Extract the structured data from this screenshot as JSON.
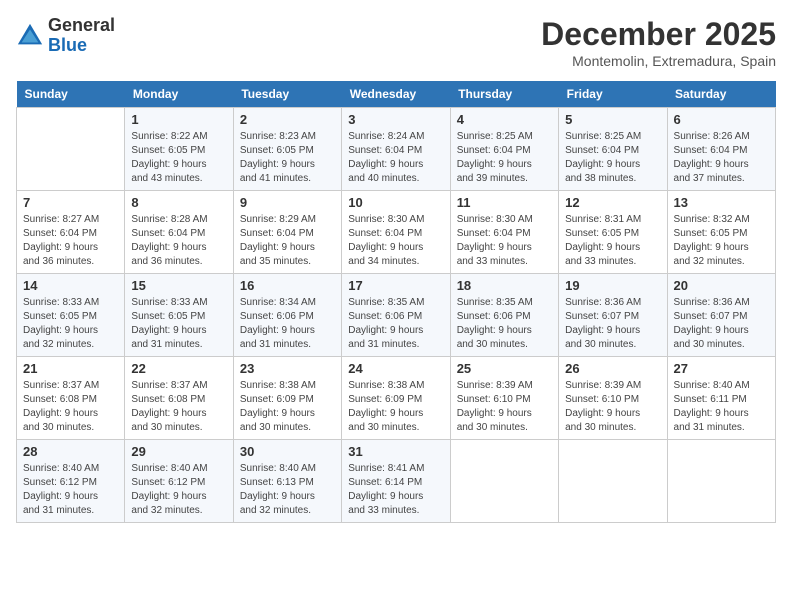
{
  "header": {
    "logo_general": "General",
    "logo_blue": "Blue",
    "month_year": "December 2025",
    "location": "Montemolin, Extremadura, Spain"
  },
  "calendar": {
    "days_of_week": [
      "Sunday",
      "Monday",
      "Tuesday",
      "Wednesday",
      "Thursday",
      "Friday",
      "Saturday"
    ],
    "weeks": [
      [
        {
          "day": "",
          "info": ""
        },
        {
          "day": "1",
          "info": "Sunrise: 8:22 AM\nSunset: 6:05 PM\nDaylight: 9 hours\nand 43 minutes."
        },
        {
          "day": "2",
          "info": "Sunrise: 8:23 AM\nSunset: 6:05 PM\nDaylight: 9 hours\nand 41 minutes."
        },
        {
          "day": "3",
          "info": "Sunrise: 8:24 AM\nSunset: 6:04 PM\nDaylight: 9 hours\nand 40 minutes."
        },
        {
          "day": "4",
          "info": "Sunrise: 8:25 AM\nSunset: 6:04 PM\nDaylight: 9 hours\nand 39 minutes."
        },
        {
          "day": "5",
          "info": "Sunrise: 8:25 AM\nSunset: 6:04 PM\nDaylight: 9 hours\nand 38 minutes."
        },
        {
          "day": "6",
          "info": "Sunrise: 8:26 AM\nSunset: 6:04 PM\nDaylight: 9 hours\nand 37 minutes."
        }
      ],
      [
        {
          "day": "7",
          "info": "Sunrise: 8:27 AM\nSunset: 6:04 PM\nDaylight: 9 hours\nand 36 minutes."
        },
        {
          "day": "8",
          "info": "Sunrise: 8:28 AM\nSunset: 6:04 PM\nDaylight: 9 hours\nand 36 minutes."
        },
        {
          "day": "9",
          "info": "Sunrise: 8:29 AM\nSunset: 6:04 PM\nDaylight: 9 hours\nand 35 minutes."
        },
        {
          "day": "10",
          "info": "Sunrise: 8:30 AM\nSunset: 6:04 PM\nDaylight: 9 hours\nand 34 minutes."
        },
        {
          "day": "11",
          "info": "Sunrise: 8:30 AM\nSunset: 6:04 PM\nDaylight: 9 hours\nand 33 minutes."
        },
        {
          "day": "12",
          "info": "Sunrise: 8:31 AM\nSunset: 6:05 PM\nDaylight: 9 hours\nand 33 minutes."
        },
        {
          "day": "13",
          "info": "Sunrise: 8:32 AM\nSunset: 6:05 PM\nDaylight: 9 hours\nand 32 minutes."
        }
      ],
      [
        {
          "day": "14",
          "info": "Sunrise: 8:33 AM\nSunset: 6:05 PM\nDaylight: 9 hours\nand 32 minutes."
        },
        {
          "day": "15",
          "info": "Sunrise: 8:33 AM\nSunset: 6:05 PM\nDaylight: 9 hours\nand 31 minutes."
        },
        {
          "day": "16",
          "info": "Sunrise: 8:34 AM\nSunset: 6:06 PM\nDaylight: 9 hours\nand 31 minutes."
        },
        {
          "day": "17",
          "info": "Sunrise: 8:35 AM\nSunset: 6:06 PM\nDaylight: 9 hours\nand 31 minutes."
        },
        {
          "day": "18",
          "info": "Sunrise: 8:35 AM\nSunset: 6:06 PM\nDaylight: 9 hours\nand 30 minutes."
        },
        {
          "day": "19",
          "info": "Sunrise: 8:36 AM\nSunset: 6:07 PM\nDaylight: 9 hours\nand 30 minutes."
        },
        {
          "day": "20",
          "info": "Sunrise: 8:36 AM\nSunset: 6:07 PM\nDaylight: 9 hours\nand 30 minutes."
        }
      ],
      [
        {
          "day": "21",
          "info": "Sunrise: 8:37 AM\nSunset: 6:08 PM\nDaylight: 9 hours\nand 30 minutes."
        },
        {
          "day": "22",
          "info": "Sunrise: 8:37 AM\nSunset: 6:08 PM\nDaylight: 9 hours\nand 30 minutes."
        },
        {
          "day": "23",
          "info": "Sunrise: 8:38 AM\nSunset: 6:09 PM\nDaylight: 9 hours\nand 30 minutes."
        },
        {
          "day": "24",
          "info": "Sunrise: 8:38 AM\nSunset: 6:09 PM\nDaylight: 9 hours\nand 30 minutes."
        },
        {
          "day": "25",
          "info": "Sunrise: 8:39 AM\nSunset: 6:10 PM\nDaylight: 9 hours\nand 30 minutes."
        },
        {
          "day": "26",
          "info": "Sunrise: 8:39 AM\nSunset: 6:10 PM\nDaylight: 9 hours\nand 30 minutes."
        },
        {
          "day": "27",
          "info": "Sunrise: 8:40 AM\nSunset: 6:11 PM\nDaylight: 9 hours\nand 31 minutes."
        }
      ],
      [
        {
          "day": "28",
          "info": "Sunrise: 8:40 AM\nSunset: 6:12 PM\nDaylight: 9 hours\nand 31 minutes."
        },
        {
          "day": "29",
          "info": "Sunrise: 8:40 AM\nSunset: 6:12 PM\nDaylight: 9 hours\nand 32 minutes."
        },
        {
          "day": "30",
          "info": "Sunrise: 8:40 AM\nSunset: 6:13 PM\nDaylight: 9 hours\nand 32 minutes."
        },
        {
          "day": "31",
          "info": "Sunrise: 8:41 AM\nSunset: 6:14 PM\nDaylight: 9 hours\nand 33 minutes."
        },
        {
          "day": "",
          "info": ""
        },
        {
          "day": "",
          "info": ""
        },
        {
          "day": "",
          "info": ""
        }
      ]
    ]
  }
}
